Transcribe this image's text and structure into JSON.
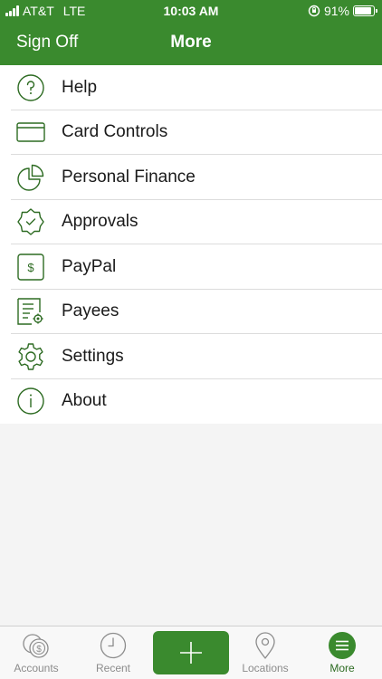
{
  "status_bar": {
    "carrier": "AT&T",
    "network": "LTE",
    "time": "10:03 AM",
    "battery_percent": "91%",
    "battery_level": 0.91
  },
  "header": {
    "left_action": "Sign Off",
    "title": "More",
    "background_color": "#3a8a2e"
  },
  "menu": {
    "items": [
      {
        "label": "Help",
        "icon": "help-circle-icon"
      },
      {
        "label": "Card Controls",
        "icon": "credit-card-icon"
      },
      {
        "label": "Personal Finance",
        "icon": "pie-chart-icon"
      },
      {
        "label": "Approvals",
        "icon": "approval-badge-icon"
      },
      {
        "label": "PayPal",
        "icon": "dollar-card-icon"
      },
      {
        "label": "Payees",
        "icon": "payee-document-icon"
      },
      {
        "label": "Settings",
        "icon": "gear-icon"
      },
      {
        "label": "About",
        "icon": "info-circle-icon"
      }
    ]
  },
  "tabbar": {
    "tabs": [
      {
        "label": "Accounts",
        "icon": "accounts-coins-icon"
      },
      {
        "label": "Recent",
        "icon": "clock-icon"
      },
      {
        "label": "Locations",
        "icon": "location-pin-icon"
      },
      {
        "label": "More",
        "icon": "menu-icon",
        "active": true
      }
    ],
    "add_button_icon": "plus-icon"
  }
}
